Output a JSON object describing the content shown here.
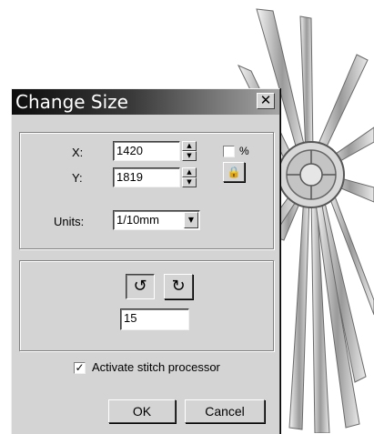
{
  "dialog": {
    "title": "Change Size",
    "close_label": "✕"
  },
  "size": {
    "x_label": "X:",
    "x_value": "1420",
    "y_label": "Y:",
    "y_value": "1819",
    "percent_label": "%",
    "percent_checked": false,
    "units_label": "Units:",
    "units_value": "1/10mm"
  },
  "rotation": {
    "rotate_left_icon": "rotate-counterclockwise-icon",
    "rotate_right_icon": "rotate-clockwise-icon",
    "rotate_left_glyph": "↺",
    "rotate_right_glyph": "↻",
    "angle_value": "15"
  },
  "options": {
    "stitch_processor_label": "Activate stitch processor",
    "stitch_processor_checked": true
  },
  "buttons": {
    "ok_label": "OK",
    "cancel_label": "Cancel"
  },
  "icons": {
    "lock_glyph": "🔒",
    "spin_up_glyph": "▲",
    "spin_down_glyph": "▼",
    "dropdown_glyph": "▼",
    "check_glyph": "✓"
  }
}
